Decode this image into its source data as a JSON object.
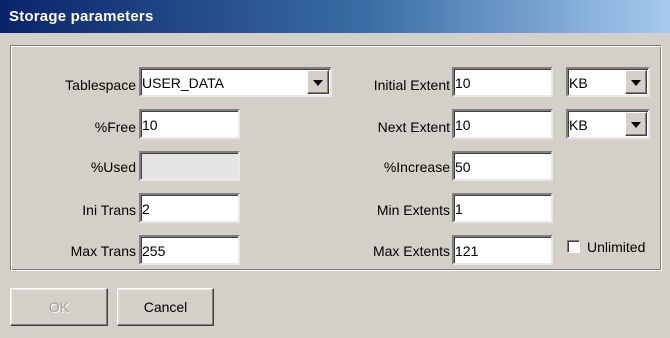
{
  "window": {
    "title": "Storage parameters"
  },
  "left": {
    "tablespace": {
      "label": "Tablespace",
      "value": "USER_DATA"
    },
    "pct_free": {
      "label": "%Free",
      "value": "10"
    },
    "pct_used": {
      "label": "%Used",
      "value": ""
    },
    "ini_trans": {
      "label": "Ini Trans",
      "value": "2"
    },
    "max_trans": {
      "label": "Max Trans",
      "value": "255"
    }
  },
  "right": {
    "initial_extent": {
      "label": "Initial Extent",
      "value": "10",
      "unit": "KB"
    },
    "next_extent": {
      "label": "Next Extent",
      "value": "10",
      "unit": "KB"
    },
    "pct_increase": {
      "label": "%Increase",
      "value": "50"
    },
    "min_extents": {
      "label": "Min Extents",
      "value": "1"
    },
    "max_extents": {
      "label": "Max Extents",
      "value": "121"
    },
    "unlimited": {
      "label": "Unlimited",
      "checked": false
    }
  },
  "buttons": {
    "ok": "OK",
    "cancel": "Cancel"
  }
}
